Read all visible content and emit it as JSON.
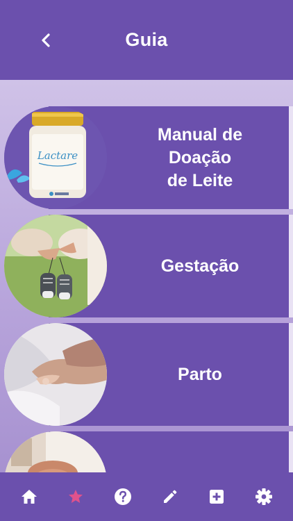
{
  "header": {
    "title": "Guia",
    "back_icon": "chevron-left-icon"
  },
  "list": [
    {
      "label": "Manual de\nDoação\nde Leite",
      "image": "milk-jar-lactare"
    },
    {
      "label": "Gestação",
      "image": "baby-shoes-pregnancy"
    },
    {
      "label": "Parto",
      "image": "newborn-hand"
    },
    {
      "label": "",
      "image": "mother-baby"
    }
  ],
  "jar_label": "Lactare",
  "nav": [
    {
      "icon": "home-icon",
      "active": false
    },
    {
      "icon": "star-icon",
      "active": true
    },
    {
      "icon": "help-icon",
      "active": false
    },
    {
      "icon": "pencil-icon",
      "active": false
    },
    {
      "icon": "plus-square-icon",
      "active": false
    },
    {
      "icon": "gear-icon",
      "active": false
    }
  ],
  "colors": {
    "primary": "#6b50ad",
    "active_nav": "#e0528c",
    "text": "#ffffff"
  }
}
